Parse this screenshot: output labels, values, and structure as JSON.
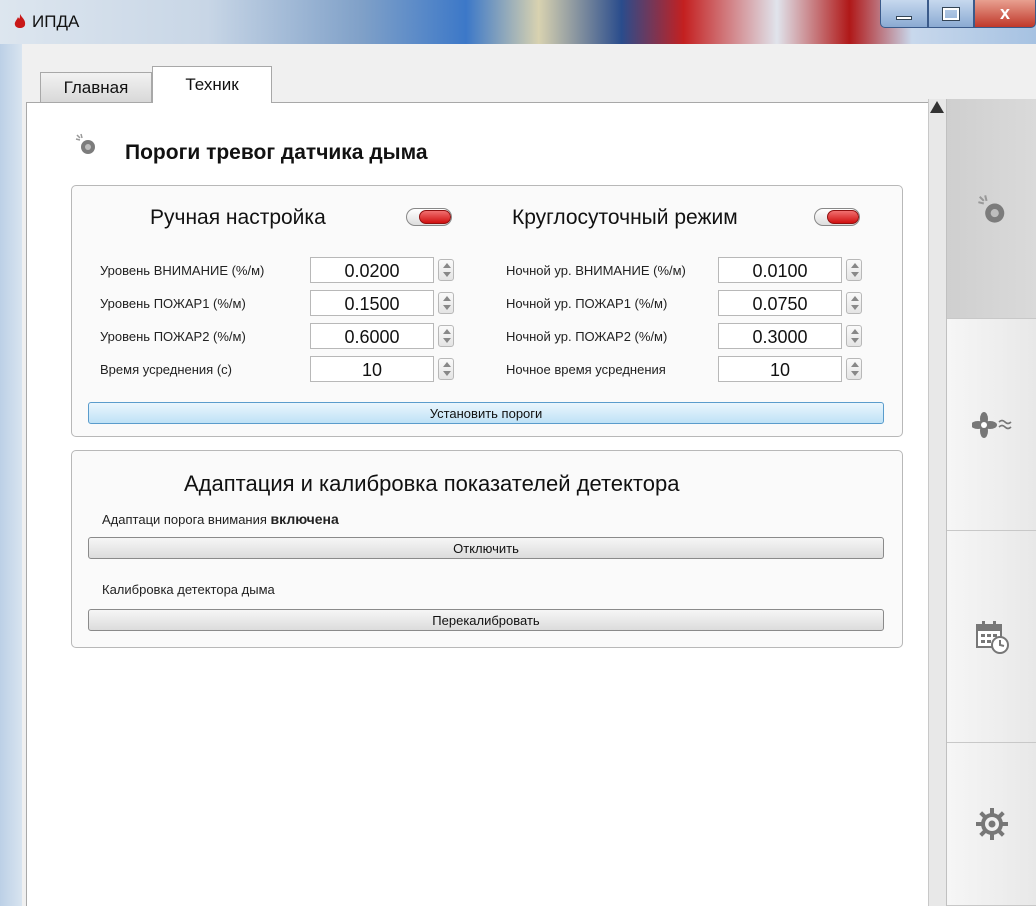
{
  "window": {
    "title": "ИПДА",
    "close_glyph": "x"
  },
  "tabs": [
    {
      "label": "Главная",
      "active": false
    },
    {
      "label": "Техник",
      "active": true
    }
  ],
  "sidebar": {
    "items": [
      {
        "icon": "smoke-detector-icon",
        "selected": true
      },
      {
        "icon": "fan-icon",
        "selected": false
      },
      {
        "icon": "calendar-clock-icon",
        "selected": false
      },
      {
        "icon": "gear-icon",
        "selected": false
      }
    ]
  },
  "header": {
    "title": "Пороги тревог датчика дыма",
    "icon": "smoke-detector-icon"
  },
  "manual": {
    "title": "Ручная настройка",
    "toggle_on": true,
    "fields": [
      {
        "label": "Уровень ВНИМАНИЕ  (%/м)",
        "value": "0.0200"
      },
      {
        "label": "Уровень ПОЖАР1 (%/м)",
        "value": "0.1500"
      },
      {
        "label": "Уровень ПОЖАР2 (%/м)",
        "value": "0.6000"
      },
      {
        "label": "Время усреднения (с)",
        "value": "10"
      }
    ]
  },
  "night": {
    "title": "Круглосуточный режим",
    "toggle_on": true,
    "fields": [
      {
        "label": "Ночной ур. ВНИМАНИЕ (%/м)",
        "value": "0.0100"
      },
      {
        "label": "Ночной ур.  ПОЖАР1 (%/м)",
        "value": "0.0750"
      },
      {
        "label": "Ночной ур.  ПОЖАР2 (%/м)",
        "value": "0.3000"
      },
      {
        "label": "Ночное время усреднения",
        "value": "10"
      }
    ]
  },
  "set_thresholds_button": "Установить пороги",
  "adaptation": {
    "title": "Адаптация и калибровка показателей детектора",
    "status_label": "Адаптаци порога внимания",
    "status_value": "включена",
    "disable_button": "Отключить",
    "calibration_label": "Калибровка детектора дыма",
    "recalibrate_button": "Перекалибровать"
  },
  "colors": {
    "toggle_red": "#d01010",
    "primary_button": "#bfe2f6"
  }
}
